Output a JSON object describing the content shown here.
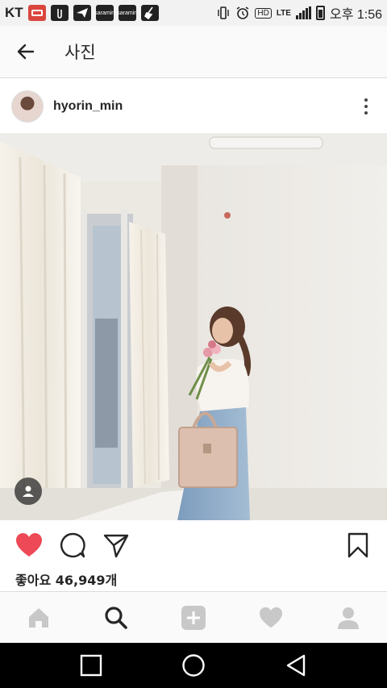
{
  "status_bar": {
    "carrier": "KT",
    "notification_icons": [
      "album-app-icon",
      "clip-icon",
      "send-icon",
      "saramin-icon",
      "saramin-icon",
      "broom-icon"
    ],
    "notification_labels": [
      "",
      "",
      "",
      "saramin",
      "saramin",
      ""
    ],
    "lte": "LTE",
    "hd": "HD",
    "time": "오후 1:56"
  },
  "header": {
    "title": "사진",
    "back_icon": "back-arrow-icon"
  },
  "post": {
    "username": "hyorin_min",
    "likes_text": "좋아요 46,949개",
    "liked": true,
    "like_color": "#ed4956"
  },
  "tabs": [
    "home-icon",
    "search-icon",
    "add-icon",
    "heart-icon",
    "profile-icon"
  ],
  "active_tab": "search-icon",
  "colors": {
    "icon_inactive": "#c8c8c8",
    "icon_active": "#262626"
  }
}
